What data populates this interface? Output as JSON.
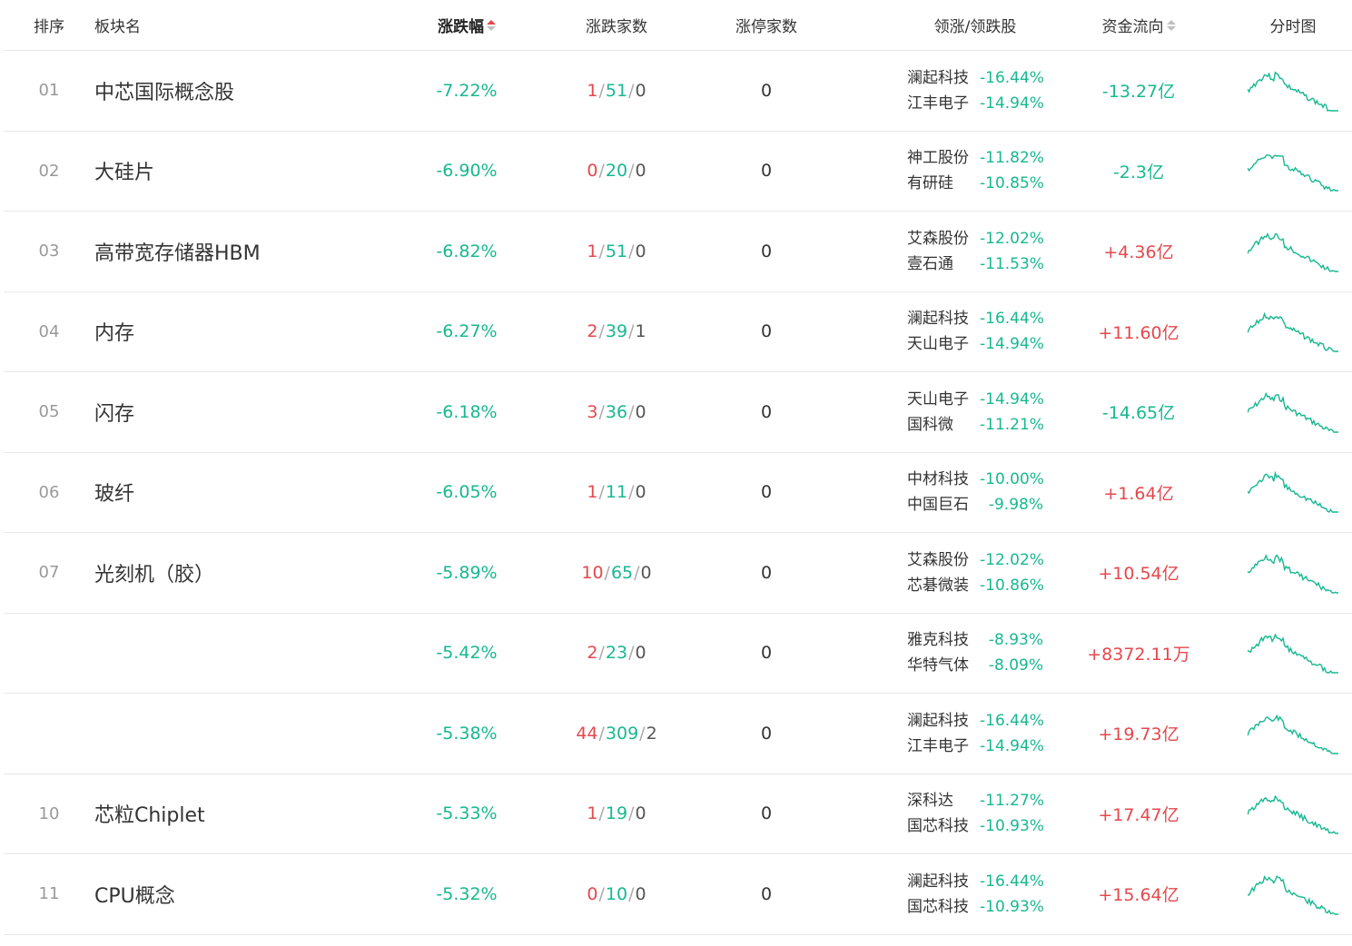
{
  "header": {
    "rank": "排序",
    "name": "板块名",
    "change": "涨跌幅",
    "counts": "涨跌家数",
    "limit_up": "涨停家数",
    "leaders": "领涨/领跌股",
    "flow": "资金流向",
    "chart": "分时图"
  },
  "colors": {
    "down": "#17b890",
    "up": "#e5484d",
    "sort_active": "#e5484d"
  },
  "rows": [
    {
      "rank": "01",
      "name": "中芯国际概念股",
      "change": "-7.22%",
      "up": "1",
      "down": "51",
      "flat": "0",
      "limit": "0",
      "leaders": [
        {
          "name": "澜起科技",
          "pct": "-16.44%"
        },
        {
          "name": "江丰电子",
          "pct": "-14.94%"
        }
      ],
      "flow": "-13.27亿",
      "flow_dir": "down"
    },
    {
      "rank": "02",
      "name": "大硅片",
      "change": "-6.90%",
      "up": "0",
      "down": "20",
      "flat": "0",
      "limit": "0",
      "leaders": [
        {
          "name": "神工股份",
          "pct": "-11.82%"
        },
        {
          "name": "有研硅",
          "pct": "-10.85%"
        }
      ],
      "flow": "-2.3亿",
      "flow_dir": "down"
    },
    {
      "rank": "03",
      "name": "高带宽存储器HBM",
      "change": "-6.82%",
      "up": "1",
      "down": "51",
      "flat": "0",
      "limit": "0",
      "leaders": [
        {
          "name": "艾森股份",
          "pct": "-12.02%"
        },
        {
          "name": "壹石通",
          "pct": "-11.53%"
        }
      ],
      "flow": "+4.36亿",
      "flow_dir": "up"
    },
    {
      "rank": "04",
      "name": "内存",
      "change": "-6.27%",
      "up": "2",
      "down": "39",
      "flat": "1",
      "limit": "0",
      "leaders": [
        {
          "name": "澜起科技",
          "pct": "-16.44%"
        },
        {
          "name": "天山电子",
          "pct": "-14.94%"
        }
      ],
      "flow": "+11.60亿",
      "flow_dir": "up"
    },
    {
      "rank": "05",
      "name": "闪存",
      "change": "-6.18%",
      "up": "3",
      "down": "36",
      "flat": "0",
      "limit": "0",
      "leaders": [
        {
          "name": "天山电子",
          "pct": "-14.94%"
        },
        {
          "name": "国科微",
          "pct": "-11.21%"
        }
      ],
      "flow": "-14.65亿",
      "flow_dir": "down"
    },
    {
      "rank": "06",
      "name": "玻纤",
      "change": "-6.05%",
      "up": "1",
      "down": "11",
      "flat": "0",
      "limit": "0",
      "leaders": [
        {
          "name": "中材科技",
          "pct": "-10.00%"
        },
        {
          "name": "中国巨石",
          "pct": "-9.98%"
        }
      ],
      "flow": "+1.64亿",
      "flow_dir": "up"
    },
    {
      "rank": "07",
      "name": "光刻机（胶）",
      "change": "-5.89%",
      "up": "10",
      "down": "65",
      "flat": "0",
      "limit": "0",
      "leaders": [
        {
          "name": "艾森股份",
          "pct": "-12.02%"
        },
        {
          "name": "芯碁微装",
          "pct": "-10.86%"
        }
      ],
      "flow": "+10.54亿",
      "flow_dir": "up"
    },
    {
      "rank": "",
      "name": "",
      "change": "-5.42%",
      "up": "2",
      "down": "23",
      "flat": "0",
      "limit": "0",
      "leaders": [
        {
          "name": "雅克科技",
          "pct": "-8.93%"
        },
        {
          "name": "华特气体",
          "pct": "-8.09%"
        }
      ],
      "flow": "+8372.11万",
      "flow_dir": "up"
    },
    {
      "rank": "",
      "name": "",
      "change": "-5.38%",
      "up": "44",
      "down": "309",
      "flat": "2",
      "limit": "0",
      "leaders": [
        {
          "name": "澜起科技",
          "pct": "-16.44%"
        },
        {
          "name": "江丰电子",
          "pct": "-14.94%"
        }
      ],
      "flow": "+19.73亿",
      "flow_dir": "up"
    },
    {
      "rank": "10",
      "name": "芯粒Chiplet",
      "change": "-5.33%",
      "up": "1",
      "down": "19",
      "flat": "0",
      "limit": "0",
      "leaders": [
        {
          "name": "深科达",
          "pct": "-11.27%"
        },
        {
          "name": "国芯科技",
          "pct": "-10.93%"
        }
      ],
      "flow": "+17.47亿",
      "flow_dir": "up"
    },
    {
      "rank": "11",
      "name": "CPU概念",
      "change": "-5.32%",
      "up": "0",
      "down": "10",
      "flat": "0",
      "limit": "0",
      "leaders": [
        {
          "name": "澜起科技",
          "pct": "-16.44%"
        },
        {
          "name": "国芯科技",
          "pct": "-10.93%"
        }
      ],
      "flow": "+15.64亿",
      "flow_dir": "up"
    }
  ]
}
